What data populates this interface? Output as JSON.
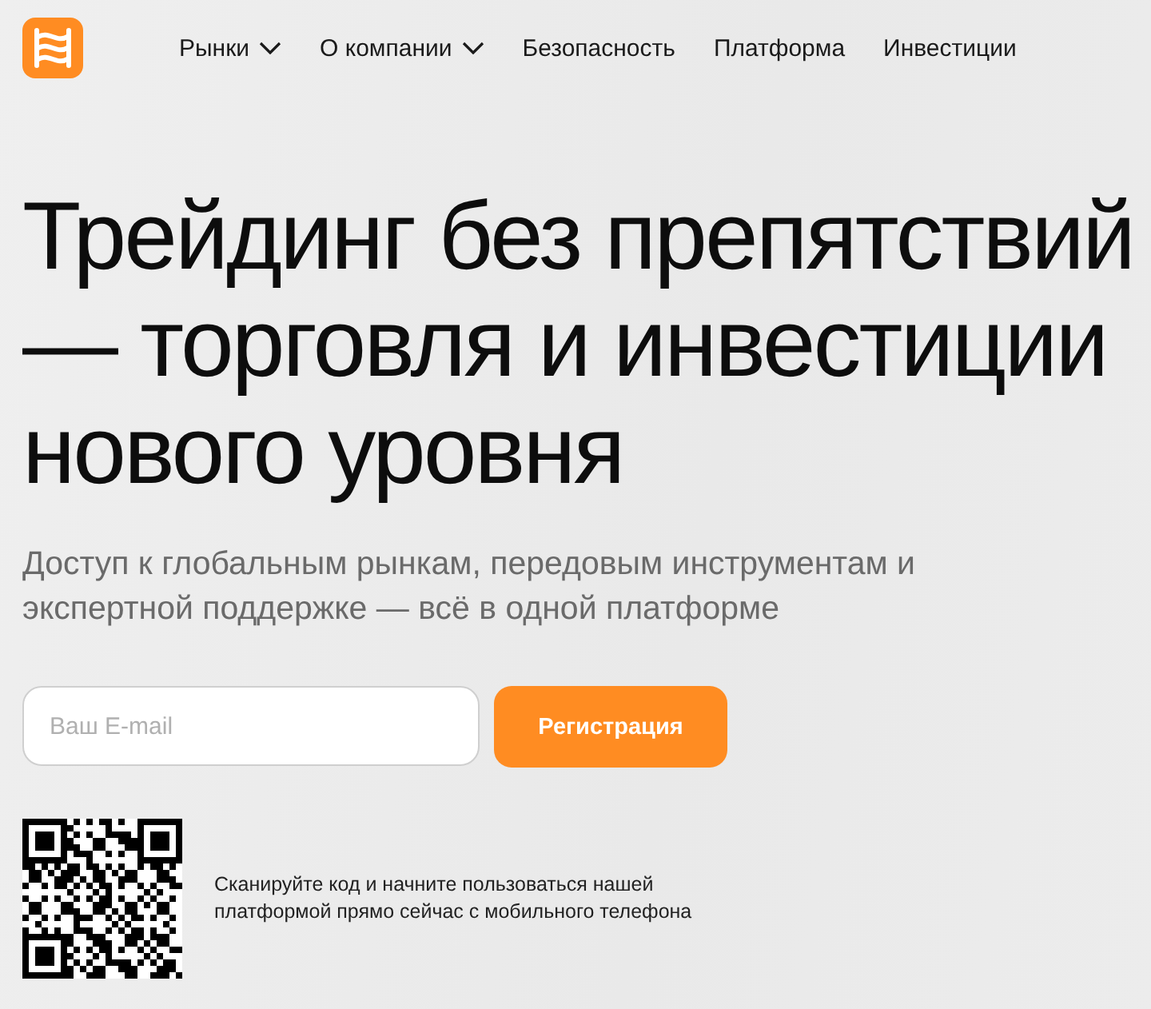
{
  "nav": [
    {
      "label": "Рынки",
      "has_menu": true
    },
    {
      "label": "О компании",
      "has_menu": true
    },
    {
      "label": "Безопасность",
      "has_menu": false
    },
    {
      "label": "Платформа",
      "has_menu": false
    },
    {
      "label": "Инвестиции",
      "has_menu": false
    }
  ],
  "hero": {
    "title_lines": [
      "Трейдинг без препятствий",
      "— торговля и инвестиции",
      "нового уровня"
    ],
    "subtitle": "Доступ к глобальным рынкам, передовым инструментам и экспертной поддержке — всё в одной платформе"
  },
  "signup": {
    "email_placeholder": "Ваш E-mail",
    "button": "Регистрация"
  },
  "qr": {
    "caption": "Сканируйте код и начните пользоваться нашей платформой прямо сейчас с мобильного телефона"
  }
}
